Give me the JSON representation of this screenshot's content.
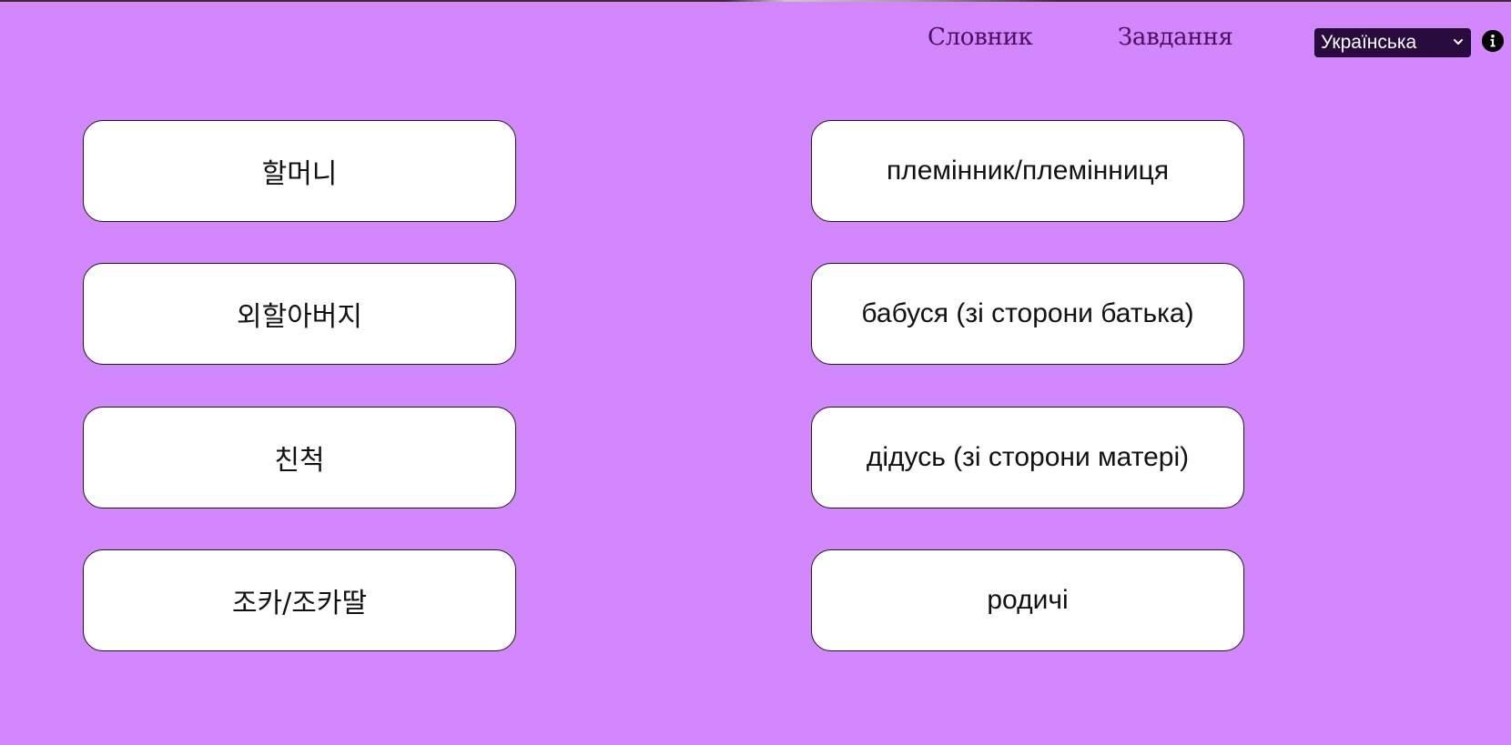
{
  "nav": {
    "dictionary_label": "Словник",
    "tasks_label": "Завдання"
  },
  "language_select": {
    "selected": "Українська"
  },
  "colors": {
    "background": "#d387fd",
    "nav_text": "#4a0f5e",
    "select_bg": "#2a0b3d",
    "card_bg": "#ffffff"
  },
  "icons": {
    "info": "info-icon",
    "select_chevron": "chevron-down-icon"
  },
  "left_cards": [
    {
      "label": "할머니"
    },
    {
      "label": "외할아버지"
    },
    {
      "label": "친척"
    },
    {
      "label": "조카/조카딸"
    }
  ],
  "right_cards": [
    {
      "label": "племінник/племінниця"
    },
    {
      "label": "бабуся (зі сторони батька)"
    },
    {
      "label": "дідусь (зі сторони матері)"
    },
    {
      "label": "родичі"
    }
  ]
}
